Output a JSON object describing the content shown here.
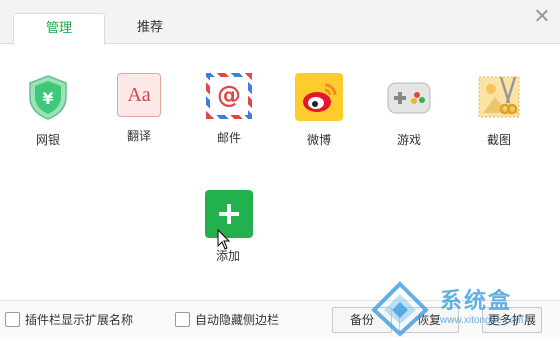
{
  "tabs": [
    {
      "label": "管理",
      "active": true
    },
    {
      "label": "推荐",
      "active": false
    }
  ],
  "apps": [
    {
      "label": "网银",
      "icon": "shield-yen-icon",
      "glyph": "¥"
    },
    {
      "label": "翻译",
      "icon": "translate-icon",
      "glyph": "Aa"
    },
    {
      "label": "邮件",
      "icon": "mail-icon",
      "glyph": "@"
    },
    {
      "label": "微博",
      "icon": "weibo-icon"
    },
    {
      "label": "游戏",
      "icon": "gamepad-icon"
    },
    {
      "label": "截图",
      "icon": "scissors-picture-icon"
    }
  ],
  "add": {
    "label": "添加"
  },
  "footer": {
    "checkbox1": "插件栏显示扩展名称",
    "checkbox2": "自动隐藏侧边栏",
    "backup": "备份",
    "restore": "恢复",
    "more": "更多扩展"
  },
  "watermark": {
    "text": "系统盒",
    "url": "www.xitonghe.com"
  },
  "colors": {
    "accent": "#1aad4e",
    "add_button": "#22b14c",
    "weibo": "#ffcc2e"
  }
}
